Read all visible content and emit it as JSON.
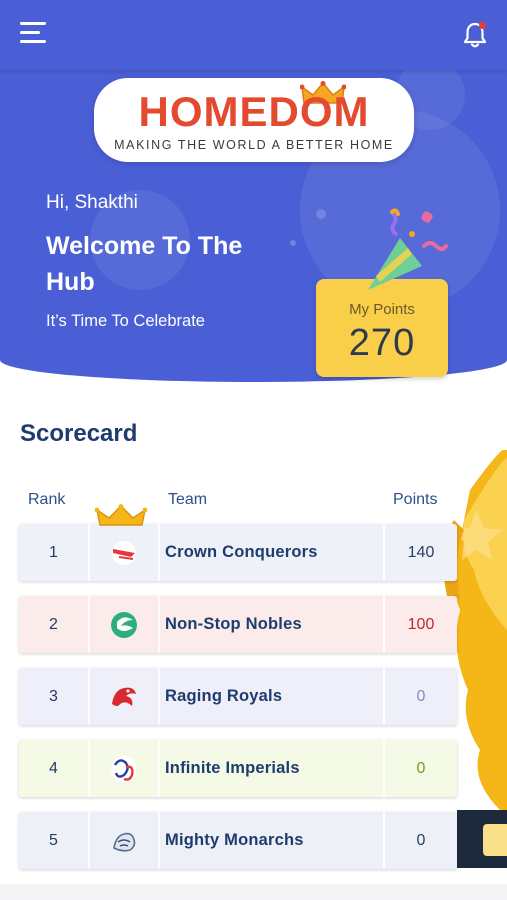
{
  "brand": {
    "name": "HOMEDOM",
    "tagline": "MAKING THE WORLD A BETTER HOME",
    "accent": "#4a5fd6",
    "logo_color": "#e44a2f"
  },
  "header": {
    "greeting": "Hi, Shakthi",
    "welcome": "Welcome To The Hub",
    "subtitle": "It’s Time To Celebrate"
  },
  "points": {
    "label": "My Points",
    "value": "270",
    "card_color": "#f9cf4a"
  },
  "scorecard": {
    "title": "Scorecard",
    "columns": {
      "rank": "Rank",
      "team": "Team",
      "points": "Points"
    },
    "rows": [
      {
        "rank": "1",
        "team": "Crown Conquerors",
        "points": "140",
        "icon": "crown-conquerors-logo",
        "bg": "#eef2f8",
        "points_color": "#2a3f63"
      },
      {
        "rank": "2",
        "team": "Non-Stop Nobles",
        "points": "100",
        "icon": "non-stop-nobles-logo",
        "bg": "#fbeceb",
        "points_color": "#c0282d"
      },
      {
        "rank": "3",
        "team": "Raging Royals",
        "points": "0",
        "icon": "raging-royals-logo",
        "bg": "#efeffa",
        "points_color": "#8a88c8"
      },
      {
        "rank": "4",
        "team": "Infinite Imperials",
        "points": "0",
        "icon": "infinite-imperials-logo",
        "bg": "#f5fae6",
        "points_color": "#7f9a1e"
      },
      {
        "rank": "5",
        "team": "Mighty Monarchs",
        "points": "0",
        "icon": "mighty-monarchs-logo",
        "bg": "#edf1f7",
        "points_color": "#2a3f63"
      }
    ]
  },
  "icons": {
    "menu": "hamburger-menu-icon",
    "bell": "notification-bell-icon",
    "trophy": "trophy-icon",
    "crown": "crown-icon"
  }
}
